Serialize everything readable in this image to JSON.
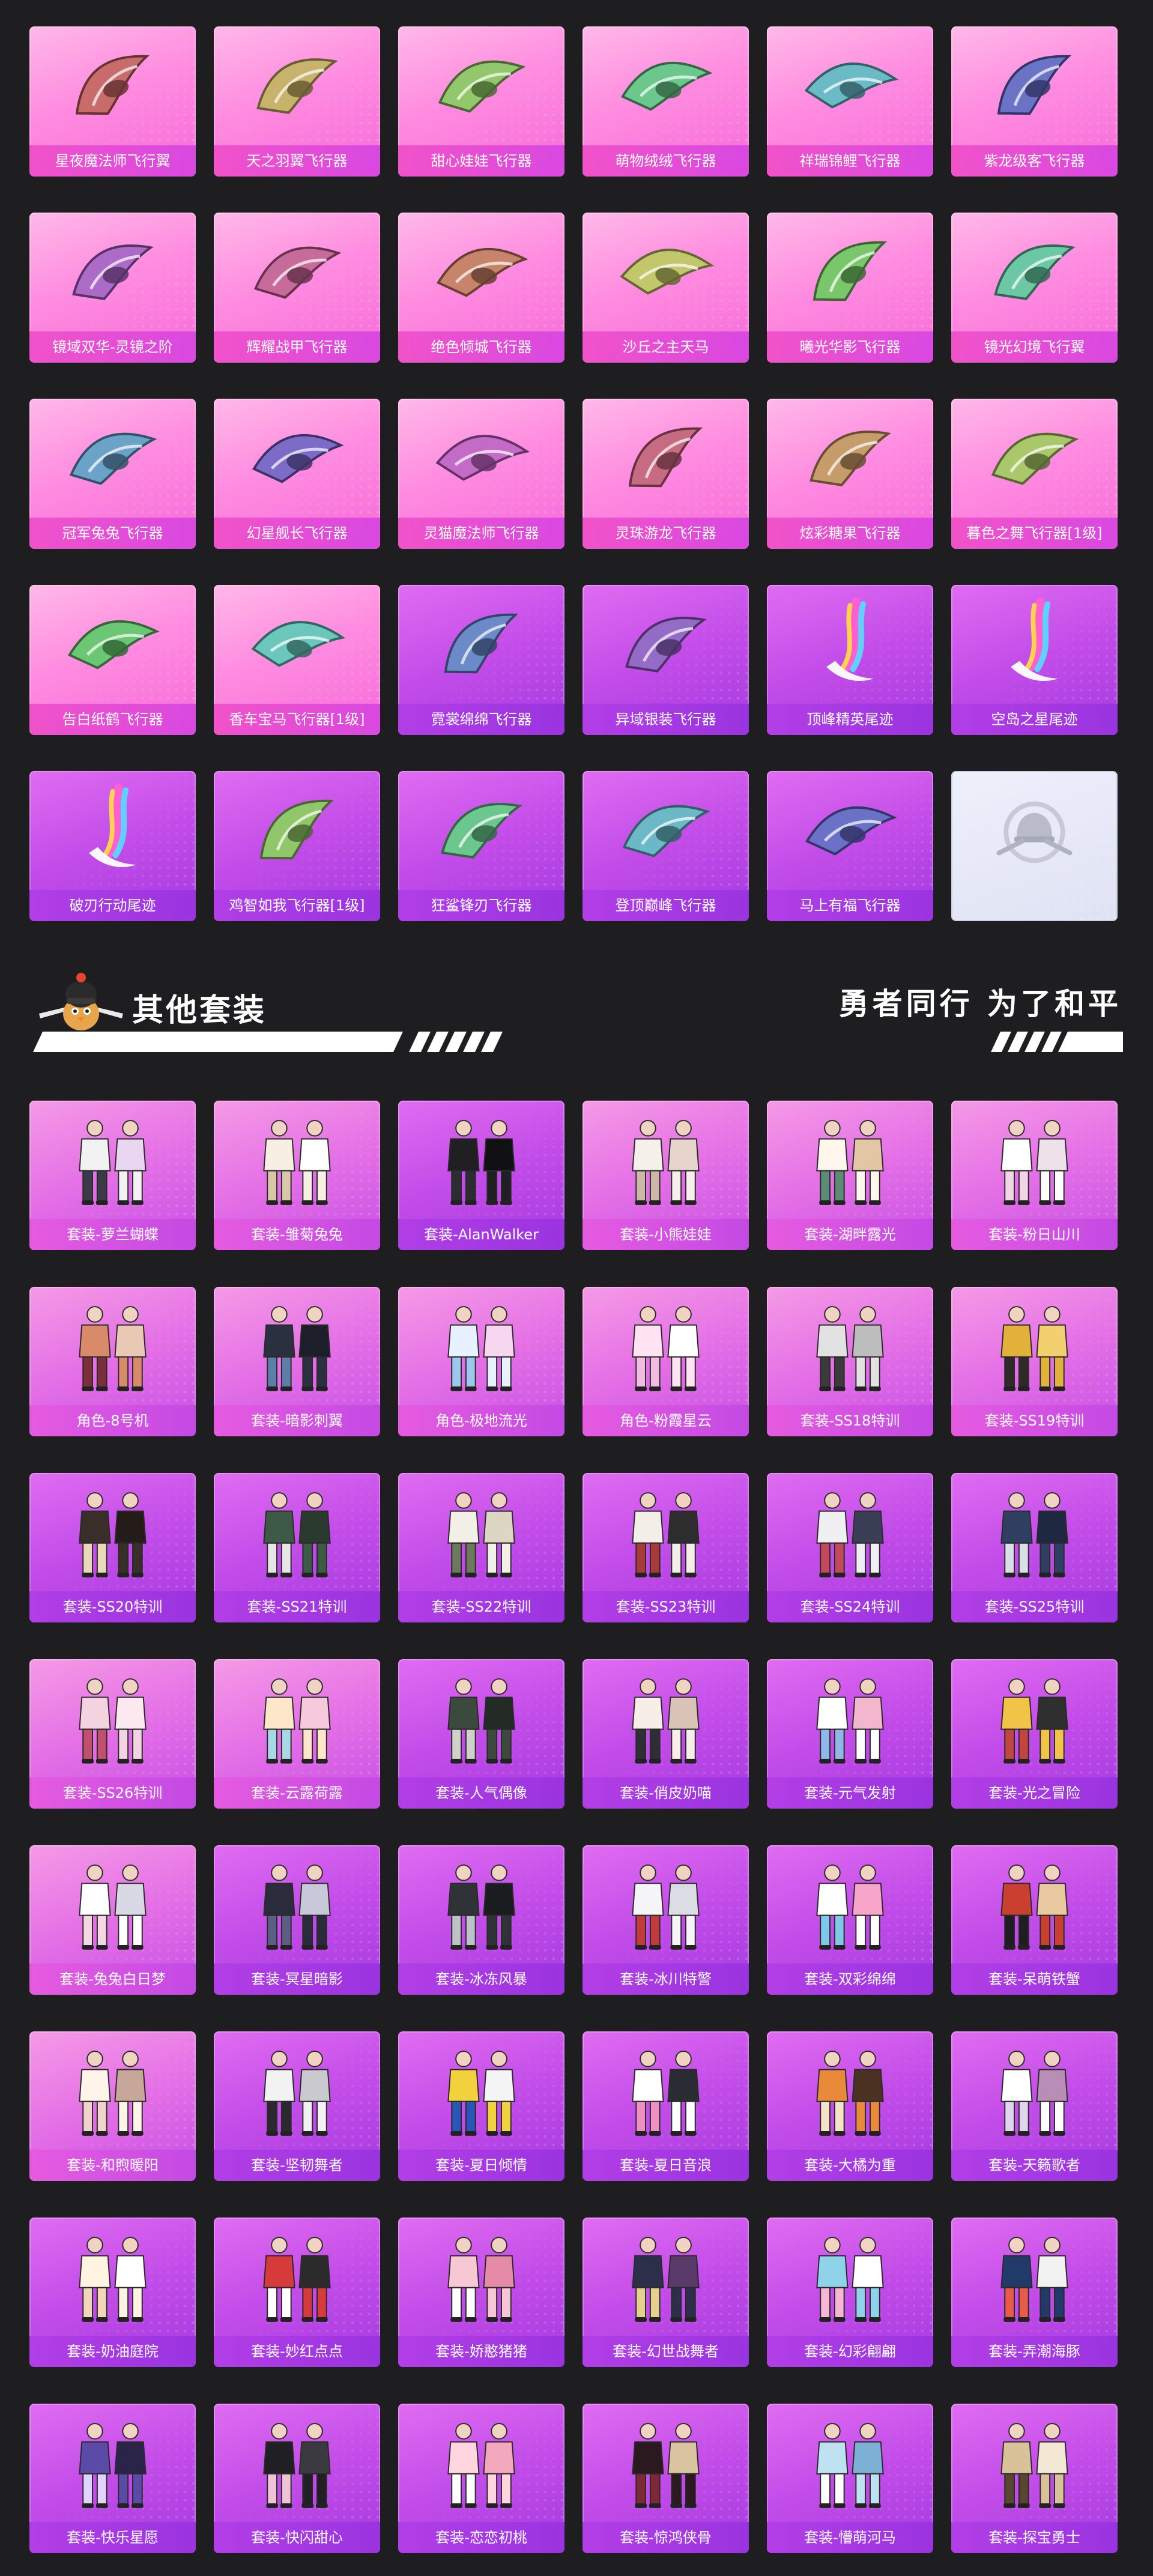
{
  "fliers": [
    {
      "label": "星夜魔法师飞行翼",
      "theme": "pink",
      "icon": "dark-wings-icon"
    },
    {
      "label": "天之羽翼飞行器",
      "theme": "pink",
      "icon": "white-wings-icon"
    },
    {
      "label": "甜心娃娃飞行器",
      "theme": "pink",
      "icon": "doll-flier-icon"
    },
    {
      "label": "萌物绒绒飞行器",
      "theme": "pink",
      "icon": "bunny-flier-icon"
    },
    {
      "label": "祥瑞锦鲤飞行器",
      "theme": "pink",
      "icon": "koi-flier-icon"
    },
    {
      "label": "紫龙级客飞行器",
      "theme": "pink",
      "icon": "dragon-flier-icon"
    },
    {
      "label": "镜域双华-灵镜之阶",
      "theme": "pink",
      "icon": "crystal-flier-icon"
    },
    {
      "label": "辉耀战甲飞行器",
      "theme": "pink",
      "icon": "armor-flier-icon"
    },
    {
      "label": "绝色倾城飞行器",
      "theme": "pink",
      "icon": "golden-flier-icon"
    },
    {
      "label": "沙丘之主天马",
      "theme": "pink",
      "icon": "pegasus-flier-icon"
    },
    {
      "label": "曦光华影飞行器",
      "theme": "pink",
      "icon": "flower-flier-icon"
    },
    {
      "label": "镜光幻境飞行翼",
      "theme": "pink",
      "icon": "mirror-wings-icon"
    },
    {
      "label": "冠军兔兔飞行器",
      "theme": "pink",
      "icon": "rabbit-jet-icon"
    },
    {
      "label": "幻星舰长飞行器",
      "theme": "pink",
      "icon": "starship-flier-icon"
    },
    {
      "label": "灵猫魔法师飞行器",
      "theme": "pink",
      "icon": "cat-flier-icon"
    },
    {
      "label": "灵珠游龙飞行器",
      "theme": "pink",
      "icon": "serpent-flier-icon"
    },
    {
      "label": "炫彩糖果飞行器",
      "theme": "pink",
      "icon": "candy-flier-icon"
    },
    {
      "label": "暮色之舞飞行器[1级]",
      "theme": "pink",
      "icon": "dusk-flier-icon"
    },
    {
      "label": "告白纸鹤飞行器",
      "theme": "pink",
      "icon": "paper-crane-icon"
    },
    {
      "label": "香车宝马飞行器[1级]",
      "theme": "pink",
      "icon": "carriage-flier-icon"
    },
    {
      "label": "霓裳绵绵飞行器",
      "theme": "purple",
      "icon": "plane-flier-icon"
    },
    {
      "label": "异域银装飞行器",
      "theme": "purple",
      "icon": "mecha-flier-icon"
    },
    {
      "label": "顶峰精英尾迹",
      "theme": "purple",
      "icon": "rainbow-trail-icon"
    },
    {
      "label": "空岛之星尾迹",
      "theme": "purple",
      "icon": "rainbow-trail-icon"
    },
    {
      "label": "破刃行动尾迹",
      "theme": "purple",
      "icon": "rainbow-trail-icon"
    },
    {
      "label": "鸡智如我飞行器[1级]",
      "theme": "purple",
      "icon": "chicken-flier-icon"
    },
    {
      "label": "狂鲨锋刃飞行器",
      "theme": "purple",
      "icon": "shark-flier-icon"
    },
    {
      "label": "登顶巅峰飞行器",
      "theme": "purple",
      "icon": "jet-flier-icon"
    },
    {
      "label": "马上有福飞行器",
      "theme": "purple",
      "icon": "horse-flier-icon"
    },
    {
      "label": "",
      "theme": "gray",
      "icon": "helmet-emblem-icon"
    }
  ],
  "section": {
    "title": "其他套装",
    "slogan": "勇者同行 为了和平"
  },
  "outfits": [
    {
      "label": "套装-萝兰蝴蝶",
      "theme": "pinkpurple",
      "palette": [
        "#f2f2f2",
        "#3a3a48",
        "#e9d6f0"
      ]
    },
    {
      "label": "套装-雏菊兔兔",
      "theme": "pinkpurple",
      "palette": [
        "#f7efe2",
        "#d9c7a8",
        "#ffffff"
      ]
    },
    {
      "label": "套装-AlanWalker",
      "theme": "purple",
      "palette": [
        "#1f1f24",
        "#2c2c33",
        "#111114"
      ]
    },
    {
      "label": "套装-小熊娃娃",
      "theme": "pinkpurple",
      "palette": [
        "#f6f0ea",
        "#cdb7a7",
        "#e7d4cd"
      ]
    },
    {
      "label": "套装-湖畔露光",
      "theme": "pinkpurple",
      "palette": [
        "#fff7ee",
        "#5a8d74",
        "#e3c7a4"
      ]
    },
    {
      "label": "套装-粉日山川",
      "theme": "pinkpurple",
      "palette": [
        "#ffffff",
        "#f2d6e6",
        "#efe1ea"
      ]
    },
    {
      "label": "角色-8号机",
      "theme": "pinkpurple",
      "palette": [
        "#d98a6a",
        "#7a2f3a",
        "#e9c8b5"
      ]
    },
    {
      "label": "套装-暗影刺翼",
      "theme": "pinkpurple",
      "palette": [
        "#2a3040",
        "#5d7ea8",
        "#1c1f29"
      ]
    },
    {
      "label": "角色-极地流光",
      "theme": "pinkpurple",
      "palette": [
        "#e7f1ff",
        "#9cc8ee",
        "#f7d6ef"
      ]
    },
    {
      "label": "角色-粉霞星云",
      "theme": "pinkpurple",
      "palette": [
        "#ffe3f3",
        "#f0bde0",
        "#ffffff"
      ]
    },
    {
      "label": "套装-SS18特训",
      "theme": "pinkpurple",
      "palette": [
        "#e2e2e2",
        "#3b3b3b",
        "#bdbdbd"
      ]
    },
    {
      "label": "套装-SS19特训",
      "theme": "pinkpurple",
      "palette": [
        "#e1b13a",
        "#2d2a28",
        "#f2d06f"
      ]
    },
    {
      "label": "套装-SS20特训",
      "theme": "purple",
      "palette": [
        "#3a2e2a",
        "#e9d9b8",
        "#241c19"
      ]
    },
    {
      "label": "套装-SS21特训",
      "theme": "purple",
      "palette": [
        "#3c5a46",
        "#e6e6e6",
        "#2a3a2f"
      ]
    },
    {
      "label": "套装-SS22特训",
      "theme": "purple",
      "palette": [
        "#f2efe6",
        "#6b7a5a",
        "#dcd6c2"
      ]
    },
    {
      "label": "套装-SS23特训",
      "theme": "purple",
      "palette": [
        "#f3efe8",
        "#a83a3a",
        "#2d2d2d"
      ]
    },
    {
      "label": "套装-SS24特训",
      "theme": "purple",
      "palette": [
        "#f0f0f4",
        "#c24a5a",
        "#3a3f56"
      ]
    },
    {
      "label": "套装-SS25特训",
      "theme": "purple",
      "palette": [
        "#2f3f62",
        "#d9dee8",
        "#1e2841"
      ]
    },
    {
      "label": "套装-SS26特训",
      "theme": "pinkpurple",
      "palette": [
        "#f3d3e0",
        "#c2506c",
        "#fbe9ef"
      ]
    },
    {
      "label": "套装-云露荷露",
      "theme": "pinkpurple",
      "palette": [
        "#fde7c8",
        "#a8d7e6",
        "#f7c9dc"
      ]
    },
    {
      "label": "套装-人气偶像",
      "theme": "purple",
      "palette": [
        "#3c4a3e",
        "#cfd3c7",
        "#242a25"
      ]
    },
    {
      "label": "套装-俏皮奶喵",
      "theme": "purple",
      "palette": [
        "#f7efe7",
        "#2e2e36",
        "#d9c3b6"
      ]
    },
    {
      "label": "套装-元气发射",
      "theme": "purple",
      "palette": [
        "#ffffff",
        "#8fb7e8",
        "#f2b7cc"
      ]
    },
    {
      "label": "套装-光之冒险",
      "theme": "purple",
      "palette": [
        "#f1c447",
        "#c2453f",
        "#2f2f2f"
      ]
    },
    {
      "label": "套装-兔兔白日梦",
      "theme": "pinkpurple",
      "palette": [
        "#ffffff",
        "#f4d7e3",
        "#d9d9e6"
      ]
    },
    {
      "label": "套装-冥星暗影",
      "theme": "purple",
      "palette": [
        "#2a2c3c",
        "#5b5f85",
        "#c8c8d8"
      ]
    },
    {
      "label": "套装-冰冻风暴",
      "theme": "purple",
      "palette": [
        "#2f3338",
        "#bcc3c8",
        "#1a1d20"
      ]
    },
    {
      "label": "套装-冰川特警",
      "theme": "purple",
      "palette": [
        "#f5f5f8",
        "#c23b3b",
        "#dcdce4"
      ]
    },
    {
      "label": "套装-双彩绵绵",
      "theme": "purple",
      "palette": [
        "#ffffff",
        "#7fc9e8",
        "#f7a6c9"
      ]
    },
    {
      "label": "套装-呆萌铁蟹",
      "theme": "purple",
      "palette": [
        "#c9402e",
        "#1e1e22",
        "#e8c9a0"
      ]
    },
    {
      "label": "套装-和煦暖阳",
      "theme": "pinkpurple",
      "palette": [
        "#fff4ea",
        "#f2d3cc",
        "#c8a79a"
      ]
    },
    {
      "label": "套装-坚韧舞者",
      "theme": "purple",
      "palette": [
        "#f2f2f2",
        "#2a2a2e",
        "#c9c9cf"
      ]
    },
    {
      "label": "套装-夏日倾情",
      "theme": "purple",
      "palette": [
        "#f2d23c",
        "#2a56b8",
        "#f4f4f4"
      ]
    },
    {
      "label": "套装-夏日音浪",
      "theme": "purple",
      "palette": [
        "#ffffff",
        "#ef8fc3",
        "#2b2b33"
      ]
    },
    {
      "label": "套装-大橘为重",
      "theme": "purple",
      "palette": [
        "#e88a3a",
        "#f4e3c6",
        "#4a3122"
      ]
    },
    {
      "label": "套装-天籁歌者",
      "theme": "purple",
      "palette": [
        "#ffffff",
        "#e0d4ee",
        "#b88eb6"
      ]
    },
    {
      "label": "套装-奶油庭院",
      "theme": "purple",
      "palette": [
        "#fff3e2",
        "#f2d6b8",
        "#ffffff"
      ]
    },
    {
      "label": "套装-妙红点点",
      "theme": "purple",
      "palette": [
        "#d73a3a",
        "#ffffff",
        "#2b2b2b"
      ]
    },
    {
      "label": "套装-娇憨猪猪",
      "theme": "purple",
      "palette": [
        "#f7c7d4",
        "#ffffff",
        "#e58aa7"
      ]
    },
    {
      "label": "套装-幻世战舞者",
      "theme": "purple",
      "palette": [
        "#2c2f4a",
        "#e6d18a",
        "#5a3a6a"
      ]
    },
    {
      "label": "套装-幻彩翩翩",
      "theme": "purple",
      "palette": [
        "#8ed3ea",
        "#f6b7d3",
        "#ffffff"
      ]
    },
    {
      "label": "套装-弄潮海豚",
      "theme": "purple",
      "palette": [
        "#213a6a",
        "#e85a4a",
        "#f2f2f2"
      ]
    },
    {
      "label": "套装-快乐星愿",
      "theme": "purple",
      "palette": [
        "#5c4aa8",
        "#e0d3ff",
        "#2a2548"
      ]
    },
    {
      "label": "套装-快闪甜心",
      "theme": "purple",
      "palette": [
        "#1f1f24",
        "#f0c2d6",
        "#3a3a40"
      ]
    },
    {
      "label": "套装-恋恋初桃",
      "theme": "purple",
      "palette": [
        "#ffd6e0",
        "#ffffff",
        "#f2a9bd"
      ]
    },
    {
      "label": "套装-惊鸿侠骨",
      "theme": "purple",
      "palette": [
        "#2a1a1f",
        "#7d2a36",
        "#d9c3a0"
      ]
    },
    {
      "label": "套装-懵萌河马",
      "theme": "purple",
      "palette": [
        "#bfe2f2",
        "#ffffff",
        "#7cb0d4"
      ]
    },
    {
      "label": "套装-探宝勇士",
      "theme": "purple",
      "palette": [
        "#d9c29a",
        "#5a4530",
        "#f2e8d4"
      ]
    }
  ]
}
